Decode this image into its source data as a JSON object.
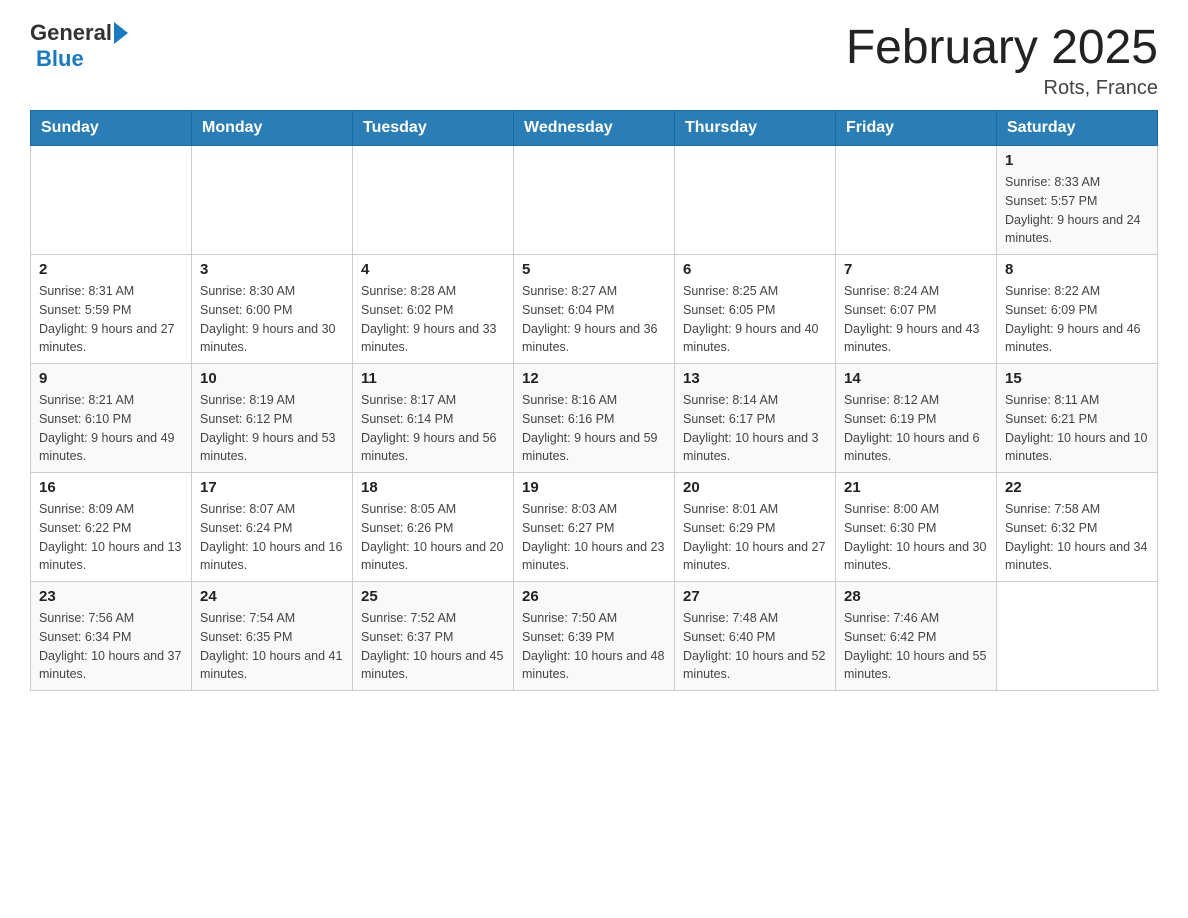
{
  "header": {
    "logo_general": "General",
    "logo_blue": "Blue",
    "title": "February 2025",
    "subtitle": "Rots, France"
  },
  "weekdays": [
    "Sunday",
    "Monday",
    "Tuesday",
    "Wednesday",
    "Thursday",
    "Friday",
    "Saturday"
  ],
  "weeks": [
    [
      {
        "day": "",
        "sunrise": "",
        "sunset": "",
        "daylight": ""
      },
      {
        "day": "",
        "sunrise": "",
        "sunset": "",
        "daylight": ""
      },
      {
        "day": "",
        "sunrise": "",
        "sunset": "",
        "daylight": ""
      },
      {
        "day": "",
        "sunrise": "",
        "sunset": "",
        "daylight": ""
      },
      {
        "day": "",
        "sunrise": "",
        "sunset": "",
        "daylight": ""
      },
      {
        "day": "",
        "sunrise": "",
        "sunset": "",
        "daylight": ""
      },
      {
        "day": "1",
        "sunrise": "Sunrise: 8:33 AM",
        "sunset": "Sunset: 5:57 PM",
        "daylight": "Daylight: 9 hours and 24 minutes."
      }
    ],
    [
      {
        "day": "2",
        "sunrise": "Sunrise: 8:31 AM",
        "sunset": "Sunset: 5:59 PM",
        "daylight": "Daylight: 9 hours and 27 minutes."
      },
      {
        "day": "3",
        "sunrise": "Sunrise: 8:30 AM",
        "sunset": "Sunset: 6:00 PM",
        "daylight": "Daylight: 9 hours and 30 minutes."
      },
      {
        "day": "4",
        "sunrise": "Sunrise: 8:28 AM",
        "sunset": "Sunset: 6:02 PM",
        "daylight": "Daylight: 9 hours and 33 minutes."
      },
      {
        "day": "5",
        "sunrise": "Sunrise: 8:27 AM",
        "sunset": "Sunset: 6:04 PM",
        "daylight": "Daylight: 9 hours and 36 minutes."
      },
      {
        "day": "6",
        "sunrise": "Sunrise: 8:25 AM",
        "sunset": "Sunset: 6:05 PM",
        "daylight": "Daylight: 9 hours and 40 minutes."
      },
      {
        "day": "7",
        "sunrise": "Sunrise: 8:24 AM",
        "sunset": "Sunset: 6:07 PM",
        "daylight": "Daylight: 9 hours and 43 minutes."
      },
      {
        "day": "8",
        "sunrise": "Sunrise: 8:22 AM",
        "sunset": "Sunset: 6:09 PM",
        "daylight": "Daylight: 9 hours and 46 minutes."
      }
    ],
    [
      {
        "day": "9",
        "sunrise": "Sunrise: 8:21 AM",
        "sunset": "Sunset: 6:10 PM",
        "daylight": "Daylight: 9 hours and 49 minutes."
      },
      {
        "day": "10",
        "sunrise": "Sunrise: 8:19 AM",
        "sunset": "Sunset: 6:12 PM",
        "daylight": "Daylight: 9 hours and 53 minutes."
      },
      {
        "day": "11",
        "sunrise": "Sunrise: 8:17 AM",
        "sunset": "Sunset: 6:14 PM",
        "daylight": "Daylight: 9 hours and 56 minutes."
      },
      {
        "day": "12",
        "sunrise": "Sunrise: 8:16 AM",
        "sunset": "Sunset: 6:16 PM",
        "daylight": "Daylight: 9 hours and 59 minutes."
      },
      {
        "day": "13",
        "sunrise": "Sunrise: 8:14 AM",
        "sunset": "Sunset: 6:17 PM",
        "daylight": "Daylight: 10 hours and 3 minutes."
      },
      {
        "day": "14",
        "sunrise": "Sunrise: 8:12 AM",
        "sunset": "Sunset: 6:19 PM",
        "daylight": "Daylight: 10 hours and 6 minutes."
      },
      {
        "day": "15",
        "sunrise": "Sunrise: 8:11 AM",
        "sunset": "Sunset: 6:21 PM",
        "daylight": "Daylight: 10 hours and 10 minutes."
      }
    ],
    [
      {
        "day": "16",
        "sunrise": "Sunrise: 8:09 AM",
        "sunset": "Sunset: 6:22 PM",
        "daylight": "Daylight: 10 hours and 13 minutes."
      },
      {
        "day": "17",
        "sunrise": "Sunrise: 8:07 AM",
        "sunset": "Sunset: 6:24 PM",
        "daylight": "Daylight: 10 hours and 16 minutes."
      },
      {
        "day": "18",
        "sunrise": "Sunrise: 8:05 AM",
        "sunset": "Sunset: 6:26 PM",
        "daylight": "Daylight: 10 hours and 20 minutes."
      },
      {
        "day": "19",
        "sunrise": "Sunrise: 8:03 AM",
        "sunset": "Sunset: 6:27 PM",
        "daylight": "Daylight: 10 hours and 23 minutes."
      },
      {
        "day": "20",
        "sunrise": "Sunrise: 8:01 AM",
        "sunset": "Sunset: 6:29 PM",
        "daylight": "Daylight: 10 hours and 27 minutes."
      },
      {
        "day": "21",
        "sunrise": "Sunrise: 8:00 AM",
        "sunset": "Sunset: 6:30 PM",
        "daylight": "Daylight: 10 hours and 30 minutes."
      },
      {
        "day": "22",
        "sunrise": "Sunrise: 7:58 AM",
        "sunset": "Sunset: 6:32 PM",
        "daylight": "Daylight: 10 hours and 34 minutes."
      }
    ],
    [
      {
        "day": "23",
        "sunrise": "Sunrise: 7:56 AM",
        "sunset": "Sunset: 6:34 PM",
        "daylight": "Daylight: 10 hours and 37 minutes."
      },
      {
        "day": "24",
        "sunrise": "Sunrise: 7:54 AM",
        "sunset": "Sunset: 6:35 PM",
        "daylight": "Daylight: 10 hours and 41 minutes."
      },
      {
        "day": "25",
        "sunrise": "Sunrise: 7:52 AM",
        "sunset": "Sunset: 6:37 PM",
        "daylight": "Daylight: 10 hours and 45 minutes."
      },
      {
        "day": "26",
        "sunrise": "Sunrise: 7:50 AM",
        "sunset": "Sunset: 6:39 PM",
        "daylight": "Daylight: 10 hours and 48 minutes."
      },
      {
        "day": "27",
        "sunrise": "Sunrise: 7:48 AM",
        "sunset": "Sunset: 6:40 PM",
        "daylight": "Daylight: 10 hours and 52 minutes."
      },
      {
        "day": "28",
        "sunrise": "Sunrise: 7:46 AM",
        "sunset": "Sunset: 6:42 PM",
        "daylight": "Daylight: 10 hours and 55 minutes."
      },
      {
        "day": "",
        "sunrise": "",
        "sunset": "",
        "daylight": ""
      }
    ]
  ]
}
